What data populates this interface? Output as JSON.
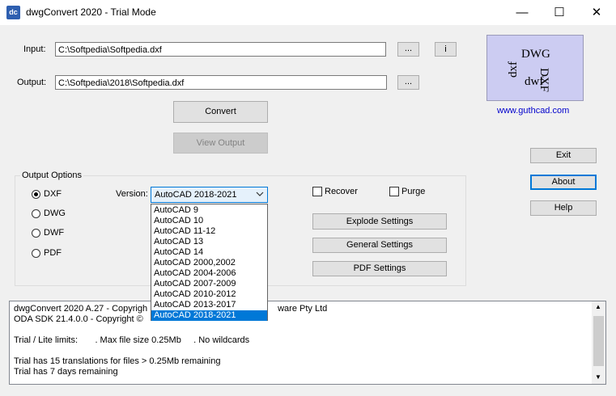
{
  "window": {
    "title": "dwgConvert 2020 - Trial Mode",
    "app_icon_text": "dc",
    "controls": {
      "minimize": "—",
      "maximize": "☐",
      "close": "✕"
    }
  },
  "input": {
    "label": "Input:",
    "value": "C:\\Softpedia\\Softpedia.dxf",
    "browse": "...",
    "info": "i"
  },
  "output": {
    "label": "Output:",
    "value": "C:\\Softpedia\\2018\\Softpedia.dxf",
    "browse": "..."
  },
  "buttons": {
    "convert": "Convert",
    "view_output": "View Output",
    "exit": "Exit",
    "about": "About",
    "help": "Help",
    "explode_settings": "Explode Settings",
    "general_settings": "General Settings",
    "pdf_settings": "PDF Settings"
  },
  "logo": {
    "w1": "DWG",
    "w2": "DXF",
    "w3": "dxf",
    "w4": "dwf",
    "url": "www.guthcad.com"
  },
  "output_options": {
    "title": "Output Options",
    "formats": [
      "DXF",
      "DWG",
      "DWF",
      "PDF"
    ],
    "selected_format": "DXF",
    "version_label": "Version:",
    "version_value": "AutoCAD 2018-2021",
    "recover": "Recover",
    "purge": "Purge"
  },
  "versions": [
    "AutoCAD 9",
    "AutoCAD 10",
    "AutoCAD 11-12",
    "AutoCAD 13",
    "AutoCAD 14",
    "AutoCAD 2000,2002",
    "AutoCAD 2004-2006",
    "AutoCAD 2007-2009",
    "AutoCAD 2010-2012",
    "AutoCAD 2013-2017",
    "AutoCAD 2018-2021"
  ],
  "log": {
    "line1_left": "dwgConvert 2020 A.27 - Copyrigh",
    "line1_right": "ware Pty Ltd",
    "line2_left": "ODA SDK 21.4.0.0 - Copyright ©",
    "line2_right": "",
    "line3": "Trial / Lite limits:       . Max file size 0.25Mb     . No wildcards",
    "line4": "",
    "line5": "Trial has 15 translations for files > 0.25Mb remaining",
    "line6": "Trial has 7 days remaining"
  },
  "colors": {
    "accent": "#0078d7",
    "logo_bg": "#ccccf2",
    "link": "#0000cc"
  }
}
